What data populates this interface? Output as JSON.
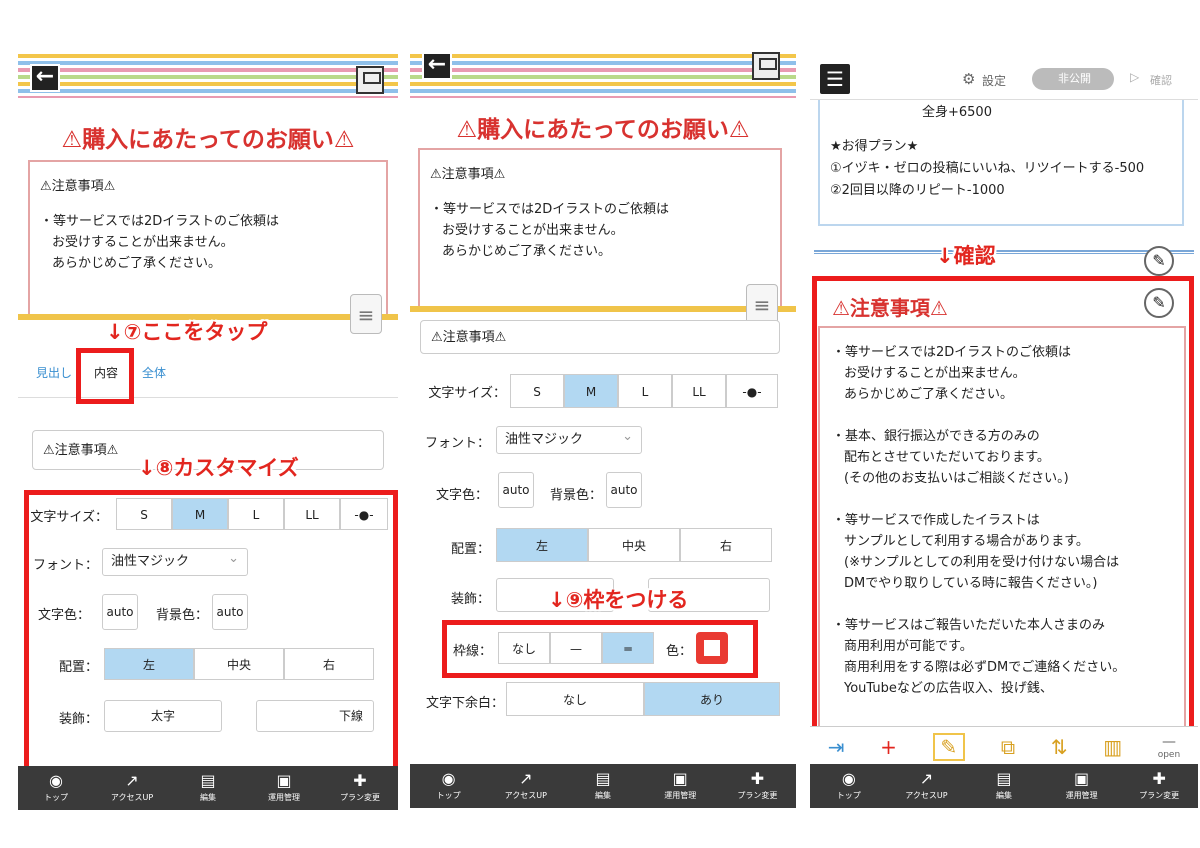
{
  "panel1": {
    "title": "⚠購入にあたってのお願い⚠",
    "notice_heading": "⚠注意事項⚠",
    "notice_lines": [
      "・等サービスでは2Dイラストのご依頼は",
      "お受けすることが出来ません。",
      "あらかじめご了承ください。"
    ],
    "annot_tap": "↓⑦ここをタップ",
    "tabs": [
      "見出し",
      "内容",
      "全体"
    ],
    "field_value": "⚠注意事項⚠",
    "annot_customize": "↓⑧カスタマイズ",
    "size_label": "文字サイズ：",
    "size_options": [
      "S",
      "M",
      "L",
      "LL",
      "-●-"
    ],
    "font_label": "フォント：",
    "font_value": "油性マジック",
    "textcolor_label": "文字色：",
    "textcolor_value": "auto",
    "bgcolor_label": "背景色：",
    "bgcolor_value": "auto",
    "align_label": "配置：",
    "align_options": [
      "左",
      "中央",
      "右"
    ],
    "deco_label": "装飾：",
    "deco_options": [
      "太字",
      "下線"
    ]
  },
  "panel2": {
    "title": "⚠購入にあたってのお願い⚠",
    "notice_heading": "⚠注意事項⚠",
    "notice_lines": [
      "・等サービスでは2Dイラストのご依頼は",
      "お受けすることが出来ません。",
      "あらかじめご了承ください。"
    ],
    "field_value": "⚠注意事項⚠",
    "size_label": "文字サイズ：",
    "size_options": [
      "S",
      "M",
      "L",
      "LL",
      "-●-"
    ],
    "font_label": "フォント：",
    "font_value": "油性マジック",
    "textcolor_label": "文字色：",
    "textcolor_value": "auto",
    "bgcolor_label": "背景色：",
    "bgcolor_value": "auto",
    "align_label": "配置：",
    "align_options": [
      "左",
      "中央",
      "右"
    ],
    "deco_label": "装飾：",
    "annot_border": "↓⑨枠をつける",
    "border_label": "枠線：",
    "border_options": [
      "なし",
      "—",
      "═"
    ],
    "border_color_label": "色：",
    "bottom_margin_label": "文字下余白：",
    "bottom_margin_options": [
      "なし",
      "あり"
    ]
  },
  "panel3": {
    "settings_label": "設定",
    "toggle_label": "非公開",
    "confirm_label": "確認",
    "top_lines": [
      "全身+6500",
      "★お得プラン★",
      "①イヅキ・ゼロの投稿にいいね、リツイートする-500",
      "②2回目以降のリピート-1000"
    ],
    "annot_confirm": "↓確認",
    "notice_heading": "⚠注意事項⚠",
    "body_paragraphs": [
      [
        "・等サービスでは2Dイラストのご依頼は",
        "お受けすることが出来ません。",
        "あらかじめご了承ください。"
      ],
      [
        "・基本、銀行振込ができる方のみの",
        "配布とさせていただいております。",
        "(その他のお支払いはご相談ください。)"
      ],
      [
        "・等サービスで作成したイラストは",
        "サンプルとして利用する場合があります。",
        "(※サンプルとしての利用を受け付けない場合は",
        "DMでやり取りしている時に報告ください。)"
      ],
      [
        "・等サービスはご報告いただいた本人さまのみ",
        "商用利用が可能です。",
        "商用利用をする際は必ずDMでご連絡ください。",
        "YouTubeなどの広告収入、投げ銭、"
      ]
    ],
    "open_label": "open"
  },
  "bottom_nav": [
    "トップ",
    "アクセスUP",
    "編集",
    "運用管理",
    "プラン変更"
  ],
  "colors": {
    "accent_red": "#e2261f",
    "selected_blue": "#b2d8f2",
    "nav_bg": "#3a3a3a"
  }
}
